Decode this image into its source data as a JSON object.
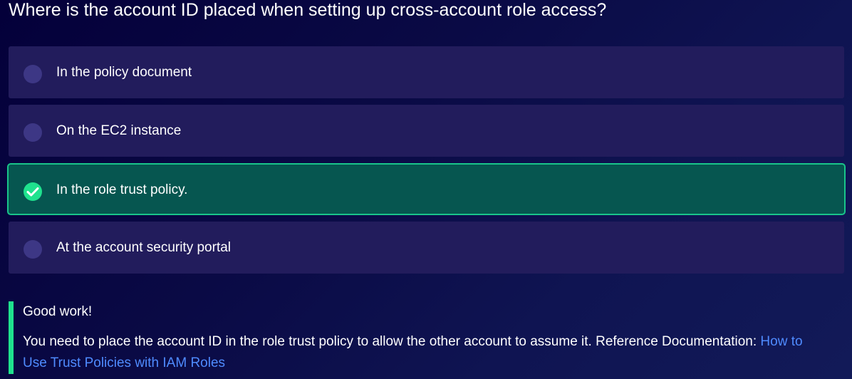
{
  "question": {
    "text": "Where is the account ID placed when setting up cross-account role access?"
  },
  "options": [
    {
      "label": "In the policy document",
      "selected": false
    },
    {
      "label": "On the EC2 instance",
      "selected": false
    },
    {
      "label": "In the role trust policy.",
      "selected": true,
      "icon": "check-icon"
    },
    {
      "label": "At the account security portal",
      "selected": false
    }
  ],
  "feedback": {
    "title": "Good work!",
    "body": "You need to place the account ID in the role trust policy to allow the other account to assume it. Reference Documentation:",
    "link_text": "How to Use Trust Policies with IAM Roles"
  },
  "colors": {
    "background": "#0a0a45",
    "option_bg": "#221c5c",
    "selected_bg": "#065650",
    "selected_border": "#19c58a",
    "accent_green": "#1fe28e",
    "link": "#4f8bff"
  }
}
